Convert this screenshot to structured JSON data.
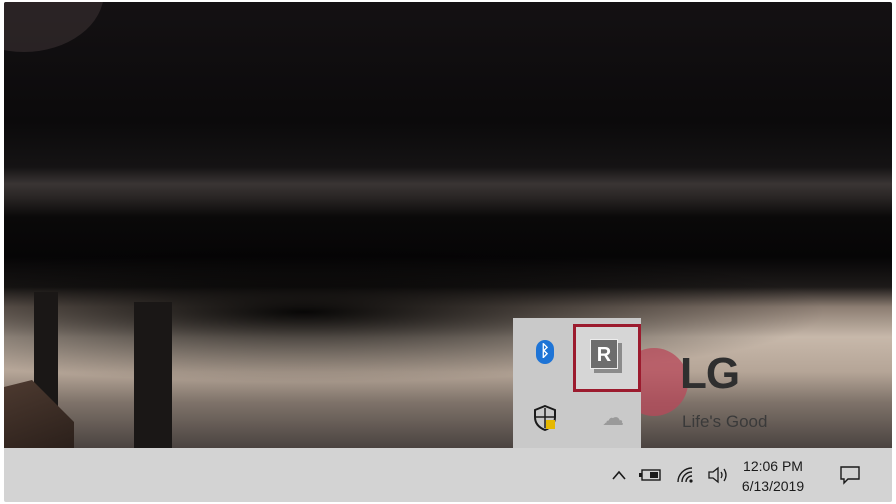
{
  "brand": {
    "logo_text": "LG",
    "slogan": "Life's Good"
  },
  "tray_overflow": {
    "items": [
      {
        "name": "bluetooth-icon",
        "glyph": "ᛒ"
      },
      {
        "name": "reader-mode-icon",
        "glyph": "R",
        "highlighted": true
      },
      {
        "name": "security-shield-icon",
        "glyph": ""
      },
      {
        "name": "onedrive-icon",
        "glyph": "☁"
      }
    ],
    "highlight_color": "#9c1b2e"
  },
  "taskbar": {
    "show_hidden_glyph": "^",
    "battery_glyph": "▭",
    "wifi_glyph": "⌔",
    "volume_glyph": "🔊︎",
    "time": "12:06 PM",
    "date": "6/13/2019",
    "notification_glyph": "🗨"
  }
}
